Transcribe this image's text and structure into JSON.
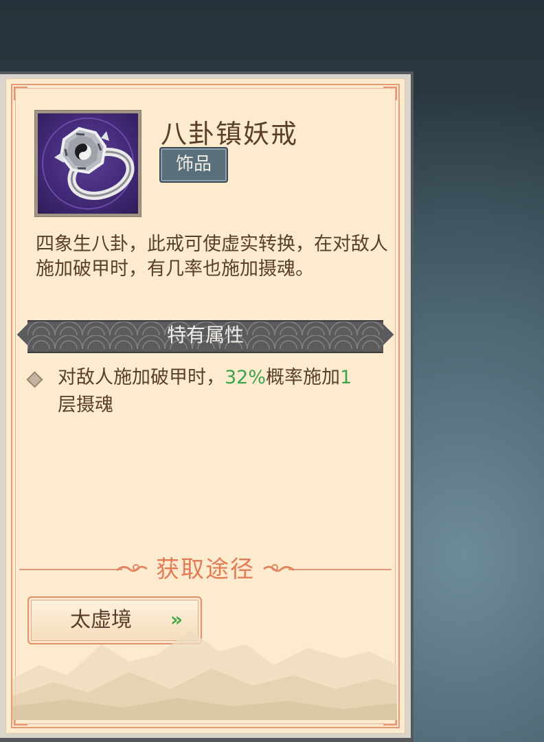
{
  "item": {
    "name": "八卦镇妖戒",
    "tag": "饰品",
    "icon": "bagua-ring-icon",
    "description": "四象生八卦，此戒可使虚实转换，在对敌人施加破甲时，有几率也施加摄魂。"
  },
  "attributes": {
    "header": "特有属性",
    "entries": [
      {
        "prefix": "对敌人施加破甲时，",
        "chance": "32%",
        "middle": "概率施加",
        "stacks": "1",
        "suffix": "层摄魂"
      }
    ]
  },
  "source": {
    "header": "获取途径",
    "button_label": "太虚境",
    "button_arrows": "»"
  },
  "colors": {
    "paper": "#fdebcf",
    "accent": "#e37c54",
    "highlight_green": "#3da34a",
    "tag_bg": "#59707b"
  }
}
